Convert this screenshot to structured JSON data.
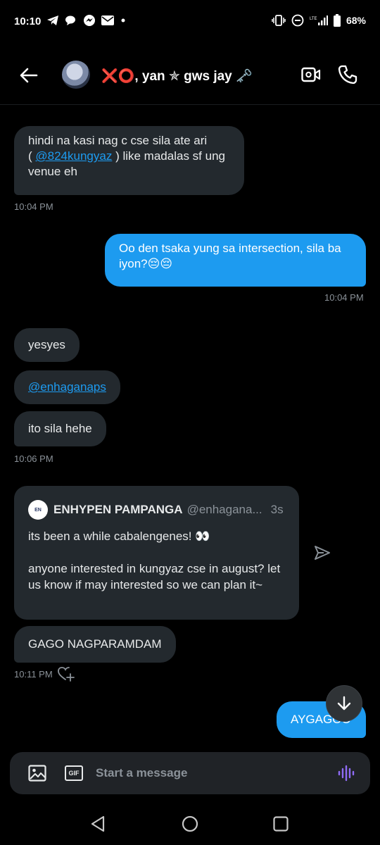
{
  "status_bar": {
    "time": "10:10",
    "battery": "68%",
    "left_icons": [
      "telegram-icon",
      "chat-bubbles-icon",
      "messenger-icon",
      "mail-icon",
      "dot-icon"
    ],
    "right_icons": [
      "vibrate-icon",
      "do-not-disturb-icon",
      "lte-signal-icon",
      "battery-icon"
    ]
  },
  "header": {
    "title_emoji": "❌⭕",
    "title_text": ", yan ✯ gws jay 🗝️",
    "actions": [
      "video-call-icon",
      "phone-call-icon"
    ]
  },
  "messages": {
    "m1": {
      "line1": "hindi na kasi nag c cse sila ate ari",
      "line2_pre": "( ",
      "mention": "@824kungyaz",
      "line2_post": " ) like madalas sf ung",
      "line3": "venue eh",
      "time": "10:04 PM"
    },
    "m2": {
      "text": "Oo den tsaka yung sa intersection, sila ba iyon?😔😔",
      "time": "10:04 PM"
    },
    "m3": {
      "text": "yesyes"
    },
    "m4": {
      "mention": "@enhaganaps"
    },
    "m5": {
      "text": "ito sila hehe",
      "time": "10:06 PM"
    },
    "quote": {
      "logo_text": "EN",
      "name": "ENHYPEN PAMPANGA",
      "handle": "@enhagana...",
      "age": "3s",
      "line1": "its been a while cabalengenes! 👀",
      "line2": "anyone interested in kungyaz cse in august? let us know if may interested so we can plan it~"
    },
    "m6": {
      "text": "GAGO NAGPARAMDAM",
      "time": "10:11 PM"
    },
    "m7": {
      "text": "AYGAGOO"
    }
  },
  "composer": {
    "placeholder": "Start a message",
    "gif_label": "GIF"
  }
}
